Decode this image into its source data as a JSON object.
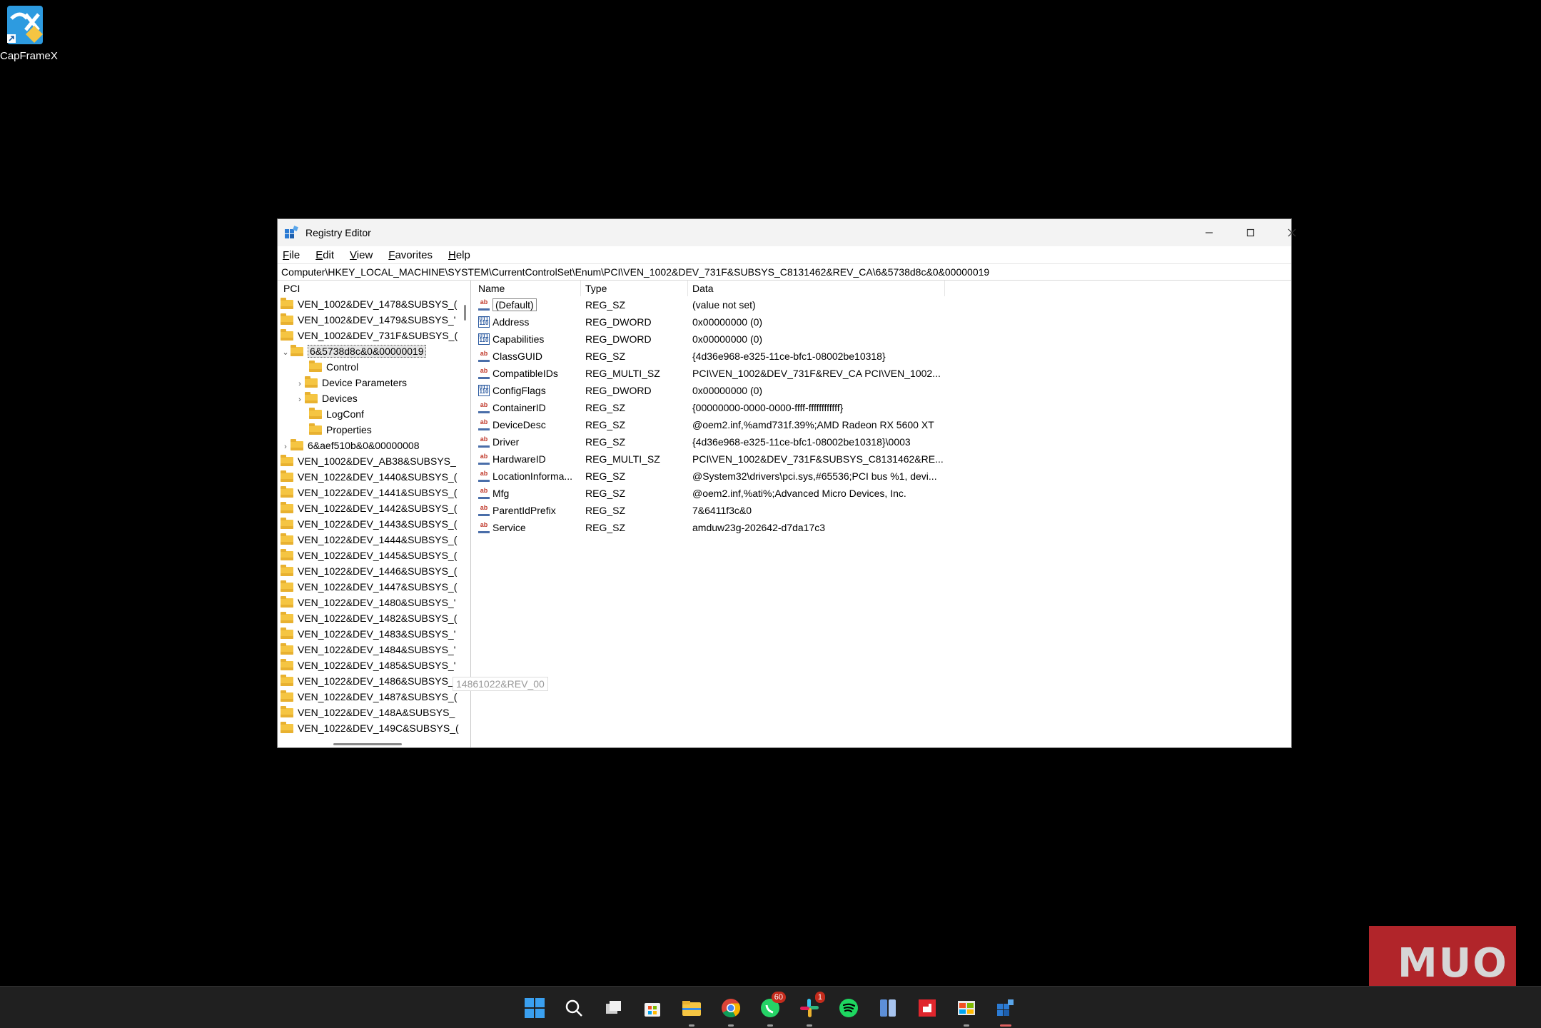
{
  "desktop": {
    "icon_label": "CapFrameX"
  },
  "window": {
    "title": "Registry Editor",
    "menu": [
      "File",
      "Edit",
      "View",
      "Favorites",
      "Help"
    ],
    "address": "Computer\\HKEY_LOCAL_MACHINE\\SYSTEM\\CurrentControlSet\\Enum\\PCI\\VEN_1002&DEV_731F&SUBSYS_C8131462&REV_CA\\6&5738d8c&0&00000019"
  },
  "tree": {
    "root": "PCI",
    "items": [
      "VEN_1002&DEV_1478&SUBSYS_(",
      "VEN_1002&DEV_1479&SUBSYS_'",
      "VEN_1002&DEV_731F&SUBSYS_(",
      "6&5738d8c&0&00000019",
      "Control",
      "Device Parameters",
      "Devices",
      "LogConf",
      "Properties",
      "6&aef510b&0&00000008",
      "VEN_1002&DEV_AB38&SUBSYS_",
      "VEN_1022&DEV_1440&SUBSYS_(",
      "VEN_1022&DEV_1441&SUBSYS_(",
      "VEN_1022&DEV_1442&SUBSYS_(",
      "VEN_1022&DEV_1443&SUBSYS_(",
      "VEN_1022&DEV_1444&SUBSYS_(",
      "VEN_1022&DEV_1445&SUBSYS_(",
      "VEN_1022&DEV_1446&SUBSYS_(",
      "VEN_1022&DEV_1447&SUBSYS_(",
      "VEN_1022&DEV_1480&SUBSYS_'",
      "VEN_1022&DEV_1482&SUBSYS_(",
      "VEN_1022&DEV_1483&SUBSYS_'",
      "VEN_1022&DEV_1484&SUBSYS_'",
      "VEN_1022&DEV_1485&SUBSYS_'",
      "VEN_1022&DEV_1486&SUBSYS_",
      "VEN_1022&DEV_1487&SUBSYS_(",
      "VEN_1022&DEV_148A&SUBSYS_",
      "VEN_1022&DEV_149C&SUBSYS_("
    ],
    "tooltip": "14861022&REV_00"
  },
  "list": {
    "headers": [
      "Name",
      "Type",
      "Data"
    ],
    "rows": [
      {
        "name": "(Default)",
        "type": "REG_SZ",
        "data": "(value not set)",
        "icon": "string-value-icon"
      },
      {
        "name": "Address",
        "type": "REG_DWORD",
        "data": "0x00000000 (0)",
        "icon": "binary-value-icon"
      },
      {
        "name": "Capabilities",
        "type": "REG_DWORD",
        "data": "0x00000000 (0)",
        "icon": "binary-value-icon"
      },
      {
        "name": "ClassGUID",
        "type": "REG_SZ",
        "data": "{4d36e968-e325-11ce-bfc1-08002be10318}",
        "icon": "string-value-icon"
      },
      {
        "name": "CompatibleIDs",
        "type": "REG_MULTI_SZ",
        "data": "PCI\\VEN_1002&DEV_731F&REV_CA PCI\\VEN_1002...",
        "icon": "string-value-icon"
      },
      {
        "name": "ConfigFlags",
        "type": "REG_DWORD",
        "data": "0x00000000 (0)",
        "icon": "binary-value-icon"
      },
      {
        "name": "ContainerID",
        "type": "REG_SZ",
        "data": "{00000000-0000-0000-ffff-ffffffffffff}",
        "icon": "string-value-icon"
      },
      {
        "name": "DeviceDesc",
        "type": "REG_SZ",
        "data": "@oem2.inf,%amd731f.39%;AMD Radeon RX 5600 XT",
        "icon": "string-value-icon"
      },
      {
        "name": "Driver",
        "type": "REG_SZ",
        "data": "{4d36e968-e325-11ce-bfc1-08002be10318}\\0003",
        "icon": "string-value-icon"
      },
      {
        "name": "HardwareID",
        "type": "REG_MULTI_SZ",
        "data": "PCI\\VEN_1002&DEV_731F&SUBSYS_C8131462&RE...",
        "icon": "string-value-icon"
      },
      {
        "name": "LocationInforma...",
        "type": "REG_SZ",
        "data": "@System32\\drivers\\pci.sys,#65536;PCI bus %1, devi...",
        "icon": "string-value-icon"
      },
      {
        "name": "Mfg",
        "type": "REG_SZ",
        "data": "@oem2.inf,%ati%;Advanced Micro Devices, Inc.",
        "icon": "string-value-icon"
      },
      {
        "name": "ParentIdPrefix",
        "type": "REG_SZ",
        "data": "7&6411f3c&0",
        "icon": "string-value-icon"
      },
      {
        "name": "Service",
        "type": "REG_SZ",
        "data": "amduw23g-202642-d7da17c3",
        "icon": "string-value-icon"
      }
    ]
  },
  "taskbar": {
    "badges": {
      "whatsapp": "60",
      "slack": "1"
    }
  },
  "watermark": {
    "text": "MUO"
  }
}
